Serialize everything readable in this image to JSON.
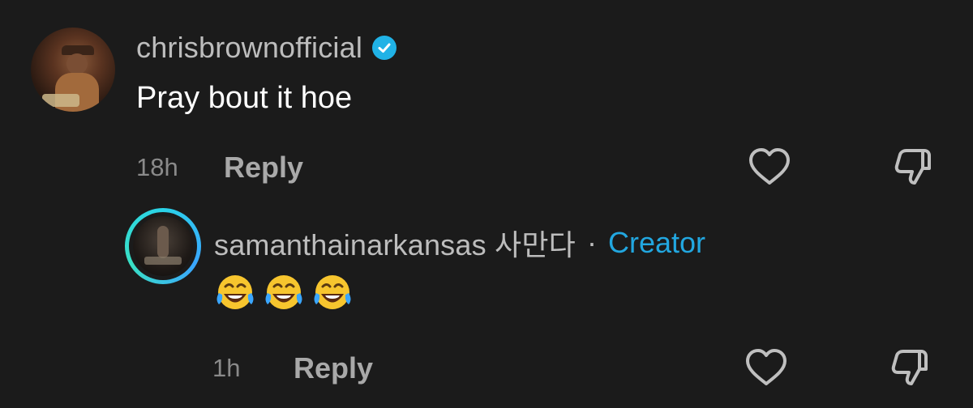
{
  "comment": {
    "username": "chrisbrownofficial",
    "text": "Pray bout it hoe",
    "time": "18h",
    "reply_label": "Reply",
    "verified": true
  },
  "reply_comment": {
    "username": "samanthainarkansas 사만다",
    "separator": "·",
    "badge": "Creator",
    "emojis": [
      "😂",
      "😂",
      "😂"
    ],
    "time": "1h",
    "reply_label": "Reply"
  },
  "icons": {
    "like": "heart-outline-icon",
    "dislike": "thumbs-down-outline-icon",
    "verified": "verified-badge-icon"
  },
  "colors": {
    "background": "#1b1b1b",
    "verified": "#20b2e6",
    "creator": "#22a7e0",
    "ring": "#2ad3e8"
  }
}
